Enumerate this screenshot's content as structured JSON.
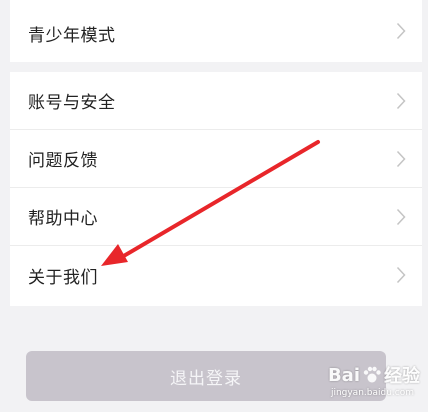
{
  "settings": {
    "items_top": [
      {
        "label": "青少年模式",
        "icon": "chevron-right-icon"
      }
    ],
    "items_main": [
      {
        "label": "账号与安全",
        "icon": "chevron-right-icon"
      },
      {
        "label": "问题反馈",
        "icon": "chevron-right-icon"
      },
      {
        "label": "帮助中心",
        "icon": "chevron-right-icon"
      },
      {
        "label": "关于我们",
        "icon": "chevron-right-icon"
      }
    ]
  },
  "logout": {
    "label": "退出登录"
  },
  "annotation": {
    "color": "#e8262a",
    "icon": "red-arrow-annotation"
  },
  "watermark": {
    "brand": "Bai",
    "brand_suffix": "经验",
    "url": "jingyan.baidu.com"
  },
  "colors": {
    "background": "#f2f2f4",
    "card": "#ffffff",
    "logout_button": "#c8c4cc",
    "chevron": "#c4c4c4"
  }
}
